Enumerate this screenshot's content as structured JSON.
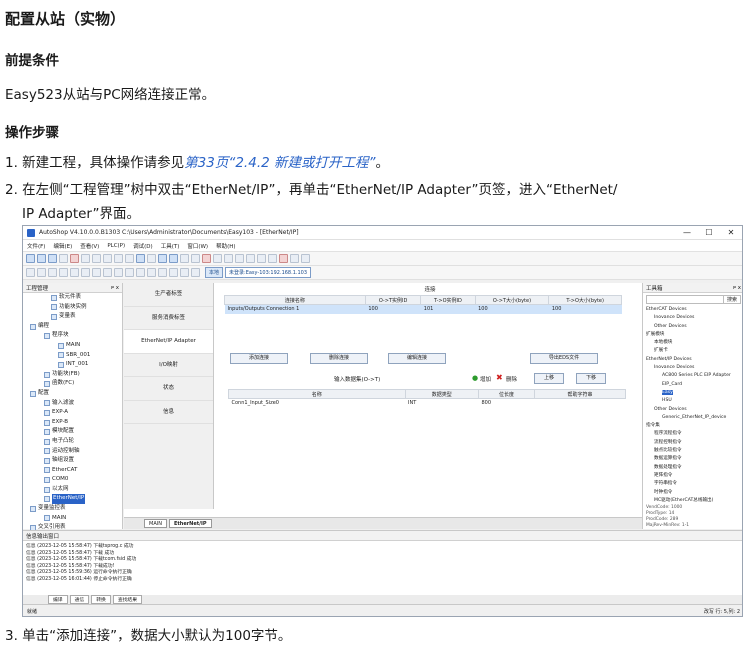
{
  "doc": {
    "title": "配置从站（实物）",
    "prereq_heading": "前提条件",
    "prereq_text": "Easy523从站与PC网络连接正常。",
    "steps_heading": "操作步骤",
    "step1_prefix": "1. 新建工程，具体操作请参见",
    "step1_link": "第33页“2.4.2 新建或打开工程”",
    "step1_suffix": "。",
    "step2_line1": "2. 在左侧“工程管理”树中双击“EtherNet/IP”，再单击“EtherNet/IP Adapter”页签，进入“EtherNet/",
    "step2_line2": "IP Adapter”界面。",
    "step3": "3. 单击“添加连接”，数据大小默认为100字节。"
  },
  "app": {
    "window_title": "AutoShop V4.10.0.0.B1303  C:\\Users\\Administrator\\Documents\\Easy103 - [EtherNet/IP]",
    "win_min": "—",
    "win_max": "☐",
    "win_close": "✕",
    "menu": [
      "文件(F)",
      "编辑(E)",
      "查看(V)",
      "PLC(P)",
      "调试(D)",
      "工具(T)",
      "窗口(W)",
      "帮助(H)"
    ],
    "toolbar_local": "本地",
    "toolbar_login": "未登录:Easy-103:192.168.1.103",
    "left_title": "工程管理",
    "left_pin": "ᴘ x",
    "tree": [
      {
        "label": "软元件表",
        "indent": 4
      },
      {
        "label": "功能块实例",
        "indent": 4
      },
      {
        "label": "变量表",
        "indent": 4
      },
      {
        "label": "编程",
        "indent": 1
      },
      {
        "label": "程序块",
        "indent": 3
      },
      {
        "label": "MAIN",
        "indent": 5
      },
      {
        "label": "SBR_001",
        "indent": 5
      },
      {
        "label": "INT_001",
        "indent": 5
      },
      {
        "label": "功能块(FB)",
        "indent": 3
      },
      {
        "label": "函数(FC)",
        "indent": 3
      },
      {
        "label": "配置",
        "indent": 1
      },
      {
        "label": "输入滤波",
        "indent": 3
      },
      {
        "label": "EXP-A",
        "indent": 3
      },
      {
        "label": "EXP-B",
        "indent": 3
      },
      {
        "label": "模块配置",
        "indent": 3
      },
      {
        "label": "电子凸轮",
        "indent": 3
      },
      {
        "label": "运动控制轴",
        "indent": 3
      },
      {
        "label": "轴组设置",
        "indent": 3
      },
      {
        "label": "EtherCAT",
        "indent": 3
      },
      {
        "label": "COM0",
        "indent": 3
      },
      {
        "label": "以太网",
        "indent": 3
      },
      {
        "label": "EtherNet/IP",
        "indent": 3,
        "selected": true
      },
      {
        "label": "变量监控表",
        "indent": 1
      },
      {
        "label": "MAIN",
        "indent": 3
      },
      {
        "label": "交叉引用表",
        "indent": 1
      }
    ],
    "cfg_nav": [
      "生产者标签",
      "服务消费标签",
      "EtherNet/IP Adapter",
      "I/O映射",
      "状态",
      "信息"
    ],
    "section_conn": "连接",
    "conn_headers": [
      "连接名称",
      "O->T实例ID",
      "T->O实例ID",
      "O->T大小(byte)",
      "T->O大小(byte)"
    ],
    "conn_rows": [
      [
        "Inputs/Outputs Connection 1",
        "100",
        "101",
        "100",
        "100"
      ]
    ],
    "btn_add": "添加连接",
    "btn_delete": "删除连接",
    "btn_edit": "编辑连接",
    "btn_export": "导出EDS文件",
    "sub_title": "输入数据集(O->T)",
    "btn_add_icon": "增加",
    "btn_del_icon": "删除",
    "btn_up": "上移",
    "btn_down": "下移",
    "sub_headers": [
      "名称",
      "数据类型",
      "位长度",
      "帮助字符串"
    ],
    "sub_rows": [
      [
        "Conn1_Input_Size0",
        "INT",
        "800",
        ""
      ]
    ],
    "bottom_tabs": [
      "MAIN",
      "EtherNet/IP"
    ],
    "right_title": "工具箱",
    "right_pin": "ᴘ x",
    "search_btn": "搜索",
    "rtree": [
      {
        "label": "EtherCAT Devices",
        "indent": 0
      },
      {
        "label": "Inovance Devices",
        "indent": 2
      },
      {
        "label": "Other Devices",
        "indent": 2
      },
      {
        "label": "扩展模块",
        "indent": 0
      },
      {
        "label": "本地模块",
        "indent": 2
      },
      {
        "label": "扩展卡",
        "indent": 2
      },
      {
        "label": "EtherNet/IP Devices",
        "indent": 0
      },
      {
        "label": "Inovance Devices",
        "indent": 2
      },
      {
        "label": "AC800 Series PLC EIP Adapter",
        "indent": 4
      },
      {
        "label": "EIP_Card",
        "indent": 4
      },
      {
        "label": "Easy",
        "indent": 4,
        "selected": true
      },
      {
        "label": "HSU",
        "indent": 4
      },
      {
        "label": "Other Devices",
        "indent": 2
      },
      {
        "label": "Generic_EtherNet_IP_device",
        "indent": 4
      },
      {
        "label": "指令集",
        "indent": 0
      },
      {
        "label": "程序流程指令",
        "indent": 2
      },
      {
        "label": "流程控制指令",
        "indent": 2
      },
      {
        "label": "触点比较指令",
        "indent": 2
      },
      {
        "label": "数据运算指令",
        "indent": 2
      },
      {
        "label": "数据处理指令",
        "indent": 2
      },
      {
        "label": "矩阵指令",
        "indent": 2
      },
      {
        "label": "字符串指令",
        "indent": 2
      },
      {
        "label": "时钟指令",
        "indent": 2
      },
      {
        "label": "MC驱动(EtherCAT总线输出)",
        "indent": 2
      }
    ],
    "rinfo": [
      "VendCode: 1000",
      "ProdType: 14",
      "ProdCode: 289",
      "MajRev-MinRev: 1-1"
    ],
    "output_title": "信息输出窗口",
    "output_lines": [
      "信息  (2023-12-05 15:58:47)  下载tsprog.c 成功",
      "信息  (2023-12-05 15:58:47)  下载 成功",
      "信息  (2023-12-05 15:58:47)  下载tcom.fsid 成功",
      "信息  (2023-12-05 15:58:47)  下载成功!",
      "信息  (2023-12-05 15:59:36)  运行命令执行正确",
      "信息  (2023-12-05 16:01:44)  停止命令执行正确"
    ],
    "output_tabs": [
      "编译",
      "通信",
      "转换",
      "查找结果"
    ],
    "status_left": "就绪",
    "status_right": "改写    行: 5,列: 2"
  }
}
